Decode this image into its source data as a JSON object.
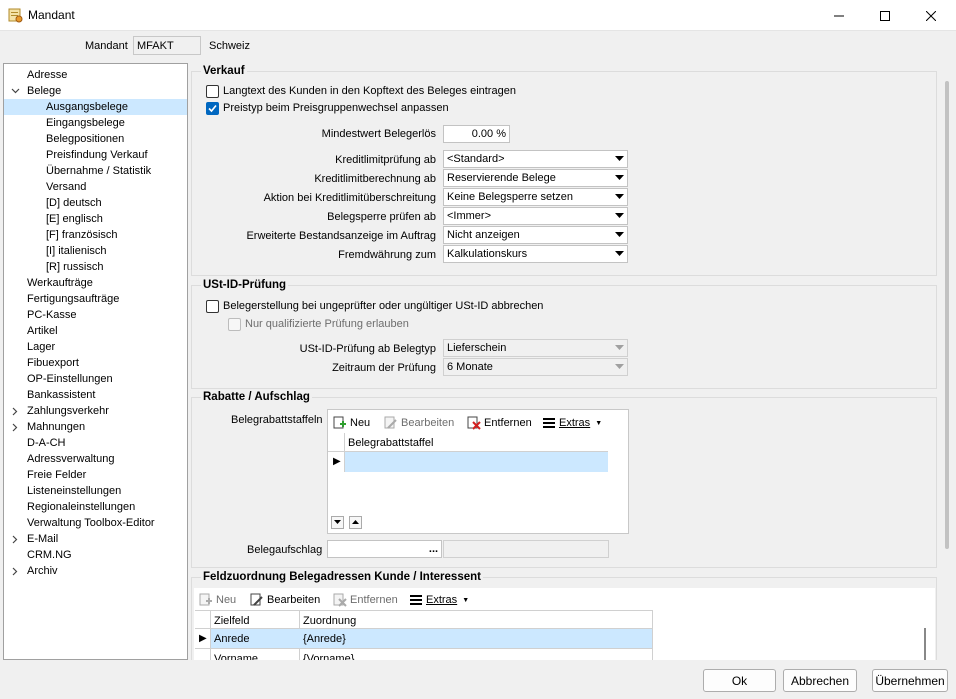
{
  "window": {
    "title": "Mandant"
  },
  "mandant": {
    "label": "Mandant",
    "code": "MFAKT",
    "name": "Schweiz"
  },
  "tree": {
    "items": [
      {
        "label": "Adresse",
        "indent": 0,
        "expander": ""
      },
      {
        "label": "Belege",
        "indent": 0,
        "expander": "down"
      },
      {
        "label": "Ausgangsbelege",
        "indent": 1,
        "expander": "",
        "selected": true
      },
      {
        "label": "Eingangsbelege",
        "indent": 1,
        "expander": ""
      },
      {
        "label": "Belegpositionen",
        "indent": 1,
        "expander": ""
      },
      {
        "label": "Preisfindung Verkauf",
        "indent": 1,
        "expander": ""
      },
      {
        "label": "Übernahme / Statistik",
        "indent": 1,
        "expander": ""
      },
      {
        "label": "Versand",
        "indent": 1,
        "expander": ""
      },
      {
        "label": "[D] deutsch",
        "indent": 1,
        "expander": ""
      },
      {
        "label": "[E] englisch",
        "indent": 1,
        "expander": ""
      },
      {
        "label": "[F] französisch",
        "indent": 1,
        "expander": ""
      },
      {
        "label": "[I] italienisch",
        "indent": 1,
        "expander": ""
      },
      {
        "label": "[R] russisch",
        "indent": 1,
        "expander": ""
      },
      {
        "label": "Werkaufträge",
        "indent": 0,
        "expander": ""
      },
      {
        "label": "Fertigungsaufträge",
        "indent": 0,
        "expander": ""
      },
      {
        "label": "PC-Kasse",
        "indent": 0,
        "expander": ""
      },
      {
        "label": "Artikel",
        "indent": 0,
        "expander": ""
      },
      {
        "label": "Lager",
        "indent": 0,
        "expander": ""
      },
      {
        "label": "Fibuexport",
        "indent": 0,
        "expander": ""
      },
      {
        "label": "OP-Einstellungen",
        "indent": 0,
        "expander": ""
      },
      {
        "label": "Bankassistent",
        "indent": 0,
        "expander": ""
      },
      {
        "label": "Zahlungsverkehr",
        "indent": 0,
        "expander": "right"
      },
      {
        "label": "Mahnungen",
        "indent": 0,
        "expander": "right"
      },
      {
        "label": "D-A-CH",
        "indent": 0,
        "expander": ""
      },
      {
        "label": "Adressverwaltung",
        "indent": 0,
        "expander": ""
      },
      {
        "label": "Freie Felder",
        "indent": 0,
        "expander": ""
      },
      {
        "label": "Listeneinstellungen",
        "indent": 0,
        "expander": ""
      },
      {
        "label": "Regionaleinstellungen",
        "indent": 0,
        "expander": ""
      },
      {
        "label": "Verwaltung Toolbox-Editor",
        "indent": 0,
        "expander": ""
      },
      {
        "label": "E-Mail",
        "indent": 0,
        "expander": "right"
      },
      {
        "label": "CRM.NG",
        "indent": 0,
        "expander": ""
      },
      {
        "label": "Archiv",
        "indent": 0,
        "expander": "right"
      }
    ]
  },
  "verkauf": {
    "title": "Verkauf",
    "cb_langtext": {
      "label": "Langtext des Kunden in den Kopftext des Beleges eintragen",
      "checked": false
    },
    "cb_preistyp": {
      "label": "Preistyp beim Preisgruppenwechsel anpassen",
      "checked": true
    },
    "mindestwert": {
      "label": "Mindestwert Belegerlös",
      "value": "0.00 %"
    },
    "kreditlimitpruefung": {
      "label": "Kreditlimitprüfung ab",
      "value": "<Standard>"
    },
    "kreditlimitberechnung": {
      "label": "Kreditlimitberechnung ab",
      "value": "Reservierende Belege"
    },
    "aktion": {
      "label": "Aktion bei Kreditlimitüberschreitung",
      "value": "Keine Belegsperre setzen"
    },
    "belegsperre": {
      "label": "Belegsperre prüfen ab",
      "value": "<Immer>"
    },
    "bestandsanzeige": {
      "label": "Erweiterte Bestandsanzeige im Auftrag",
      "value": "Nicht anzeigen"
    },
    "fremdwaehrung": {
      "label": "Fremdwährung zum",
      "value": "Kalkulationskurs"
    }
  },
  "ustid": {
    "title": "USt-ID-Prüfung",
    "cb_abbrechen": {
      "label": "Belegerstellung bei ungeprüfter oder ungültiger USt-ID abbrechen",
      "checked": false
    },
    "cb_qualifiziert": {
      "label": "Nur qualifizierte Prüfung erlauben",
      "checked": false
    },
    "ab_belegtyp": {
      "label": "USt-ID-Prüfung ab Belegtyp",
      "value": "Lieferschein"
    },
    "zeitraum": {
      "label": "Zeitraum der Prüfung",
      "value": "6 Monate"
    }
  },
  "rabatte": {
    "title": "Rabatte / Aufschlag",
    "staffeln_label": "Belegrabattstaffeln",
    "toolbar": {
      "neu": "Neu",
      "bearbeiten": "Bearbeiten",
      "entfernen": "Entfernen",
      "extras": "Extras"
    },
    "grid_header": "Belegrabattstaffel",
    "aufschlag_label": "Belegaufschlag",
    "aufschlag_btn": "..."
  },
  "feldzuordnung": {
    "title": "Feldzuordnung Belegadressen Kunde / Interessent",
    "toolbar": {
      "neu": "Neu",
      "bearbeiten": "Bearbeiten",
      "entfernen": "Entfernen",
      "extras": "Extras"
    },
    "columns": [
      "Zielfeld",
      "Zuordnung"
    ],
    "rows": [
      {
        "zielfeld": "Anrede",
        "zuordnung": "{Anrede}"
      },
      {
        "zielfeld": "Vorname",
        "zuordnung": "{Vorname}"
      }
    ]
  },
  "buttons": {
    "ok": "Ok",
    "abbrechen": "Abbrechen",
    "uebernehmen": "Übernehmen"
  },
  "colors": {
    "selection": "#cce8ff",
    "checkbox": "#0067c0",
    "icon_green": "#2e9e2e",
    "icon_red": "#d22020"
  }
}
